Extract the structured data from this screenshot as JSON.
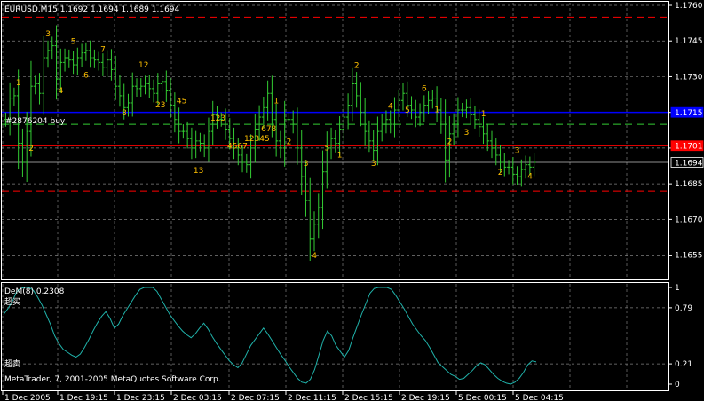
{
  "colors": {
    "background": "#000000",
    "grid": "#7f7f7f",
    "bars": "#33cc33",
    "ma_dash": "#33cc33",
    "blue_line": "#0000ff",
    "red_line": "#ff0000",
    "red_dash": "#ff0000",
    "price_line": "#c0c0c0",
    "marker_text": "#ffc000",
    "indicator_line": "#20b2aa",
    "text": "#ffffff"
  },
  "main": {
    "header": "EURUSD,M15  1.1692 1.1694 1.1689 1.1694",
    "object_label": "#2876204 buy",
    "price_axis": {
      "min": 1.165,
      "max": 1.176,
      "ticks": [
        "1.1760",
        "1.1745",
        "1.1730",
        "1.1715",
        "1.1700",
        "1.1685",
        "1.1670",
        "1.1655"
      ],
      "tags": [
        {
          "text": "1.1715",
          "value": 1.1715,
          "color": "#0000ff"
        },
        {
          "text": "1.1701",
          "value": 1.1701,
          "color": "#ff0000"
        },
        {
          "text": "1.1694",
          "value": 1.1694,
          "color": "#ffffff"
        }
      ]
    },
    "levels": {
      "blue": 1.1715,
      "red_solid": 1.1701,
      "red_dash_top": 1.1755,
      "red_dash_bottom": 1.1682,
      "green_dash": 1.171,
      "current": 1.1694
    },
    "marker_labels": [
      "1",
      "2",
      "3",
      "4",
      "5",
      "6",
      "7",
      "8",
      "12",
      "23",
      "45",
      "13",
      "123",
      "4567",
      "12345",
      "678",
      "1",
      "2",
      "3",
      "4",
      "5",
      "1",
      "2",
      "3",
      "4",
      "5",
      "6",
      "1",
      "2",
      "3",
      "1",
      "2",
      "3",
      "4"
    ]
  },
  "indicator": {
    "header": "DeM(8) 0.2308",
    "level_high": "超买",
    "level_low": "超卖",
    "copyright": "MetaTrader, 7, 2001-2005 MetaQuotes Software Corp.",
    "ticks": [
      "1",
      "0.79",
      "0.21",
      "0"
    ],
    "series_values": [
      0.72,
      0.78,
      0.85,
      0.95,
      0.99,
      1,
      1,
      0.97,
      0.9,
      0.82,
      0.72,
      0.62,
      0.5,
      0.42,
      0.36,
      0.33,
      0.3,
      0.28,
      0.31,
      0.38,
      0.46,
      0.55,
      0.63,
      0.7,
      0.75,
      0.68,
      0.58,
      0.62,
      0.71,
      0.78,
      0.85,
      0.92,
      0.98,
      1,
      1,
      1,
      0.96,
      0.88,
      0.8,
      0.72,
      0.66,
      0.6,
      0.55,
      0.51,
      0.48,
      0.52,
      0.58,
      0.63,
      0.57,
      0.49,
      0.42,
      0.36,
      0.3,
      0.24,
      0.2,
      0.17,
      0.22,
      0.31,
      0.4,
      0.46,
      0.52,
      0.58,
      0.52,
      0.45,
      0.38,
      0.31,
      0.25,
      0.18,
      0.12,
      0.06,
      0.02,
      0.01,
      0.05,
      0.15,
      0.3,
      0.45,
      0.55,
      0.5,
      0.4,
      0.34,
      0.28,
      0.35,
      0.48,
      0.6,
      0.72,
      0.83,
      0.94,
      0.99,
      1,
      1,
      1,
      0.98,
      0.92,
      0.85,
      0.78,
      0.7,
      0.62,
      0.56,
      0.5,
      0.45,
      0.38,
      0.3,
      0.22,
      0.18,
      0.14,
      0.1,
      0.08,
      0.05,
      0.06,
      0.1,
      0.14,
      0.19,
      0.22,
      0.2,
      0.15,
      0.1,
      0.06,
      0.03,
      0.01,
      0,
      0.02,
      0.06,
      0.12,
      0.2,
      0.24,
      0.23
    ]
  },
  "time_axis": [
    "1 Dec 2005",
    "1 Dec 19:15",
    "1 Dec 23:15",
    "2 Dec 03:15",
    "2 Dec 07:15",
    "2 Dec 11:15",
    "2 Dec 15:15",
    "2 Dec 19:15",
    "5 Dec 00:15",
    "5 Dec 04:15"
  ],
  "chart_data": {
    "type": "bar",
    "symbol": "EURUSD",
    "timeframe": "M15",
    "last_ohlc": {
      "open": 1.1692,
      "high": 1.1694,
      "low": 1.1689,
      "close": 1.1694
    },
    "x": [
      "1 Dec 2005",
      "1 Dec 19:15",
      "1 Dec 23:15",
      "2 Dec 03:15",
      "2 Dec 07:15",
      "2 Dec 11:15",
      "2 Dec 15:15",
      "2 Dec 19:15",
      "5 Dec 00:15",
      "5 Dec 04:15"
    ],
    "ylim": [
      1.165,
      1.176
    ],
    "close_path": [
      1.1712,
      1.1721,
      1.1722,
      1.1702,
      1.1694,
      1.1707,
      1.1726,
      1.1727,
      1.1723,
      1.1738,
      1.1741,
      1.1743,
      1.1729,
      1.1736,
      1.1738,
      1.1737,
      1.1735,
      1.1738,
      1.174,
      1.1741,
      1.1738,
      1.1737,
      1.1736,
      1.1734,
      1.1737,
      1.1733,
      1.1726,
      1.1722,
      1.1717,
      1.1719,
      1.1726,
      1.1725,
      1.1726,
      1.1727,
      1.1725,
      1.1723,
      1.1727,
      1.1728,
      1.1724,
      1.1718,
      1.1712,
      1.1707,
      1.1707,
      1.1704,
      1.17,
      1.1703,
      1.1702,
      1.17,
      1.1707,
      1.1714,
      1.1712,
      1.1712,
      1.1708,
      1.1704,
      1.17,
      1.1697,
      1.1694,
      1.1693,
      1.17,
      1.1708,
      1.1713,
      1.1717,
      1.1723,
      1.1712,
      1.1703,
      1.17,
      1.1712,
      1.1712,
      1.171,
      1.17,
      1.1688,
      1.1678,
      1.1662,
      1.1668,
      1.1675,
      1.169,
      1.17,
      1.1704,
      1.1702,
      1.1708,
      1.1713,
      1.1718,
      1.1727,
      1.1722,
      1.1715,
      1.1707,
      1.1703,
      1.1699,
      1.1707,
      1.171,
      1.1712,
      1.171,
      1.1716,
      1.172,
      1.1723,
      1.1718,
      1.1716,
      1.1713,
      1.1715,
      1.1718,
      1.172,
      1.1721,
      1.1716,
      1.1711,
      1.1695,
      1.1706,
      1.171,
      1.1716,
      1.1716,
      1.1717,
      1.1714,
      1.1712,
      1.1709,
      1.1706,
      1.1703,
      1.17,
      1.1697,
      1.1694,
      1.1692,
      1.1692,
      1.1689,
      1.1688,
      1.1691,
      1.1693,
      1.1692,
      1.1694
    ]
  }
}
